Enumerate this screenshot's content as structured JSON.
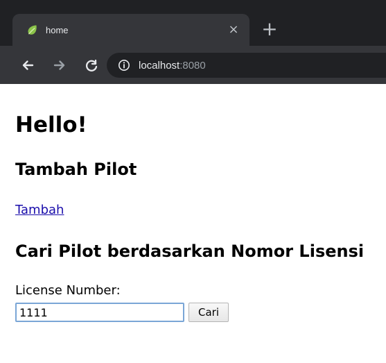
{
  "browser": {
    "tab": {
      "title": "home",
      "close_symbol": "×"
    },
    "new_tab_symbol": "+",
    "address": {
      "host": "localhost",
      "port": ":8080"
    },
    "icons": {
      "favicon": "leaf-icon",
      "back": "arrow-left-icon",
      "forward": "arrow-right-icon",
      "reload": "reload-icon",
      "info": "info-icon"
    },
    "colors": {
      "chrome_dark": "#202124",
      "toolbar": "#35363a",
      "tab_text": "#e8eaed",
      "icon": "#bdc1c6",
      "port_text": "#9aa0a6",
      "leaf": "#8bc34a"
    }
  },
  "page": {
    "heading": "Hello!",
    "section_add_title": "Tambah Pilot",
    "add_link": "Tambah",
    "section_search_title": "Cari Pilot berdasarkan Nomor Lisensi",
    "license_label": "License Number:",
    "license_value": "1111",
    "search_button": "Cari"
  }
}
